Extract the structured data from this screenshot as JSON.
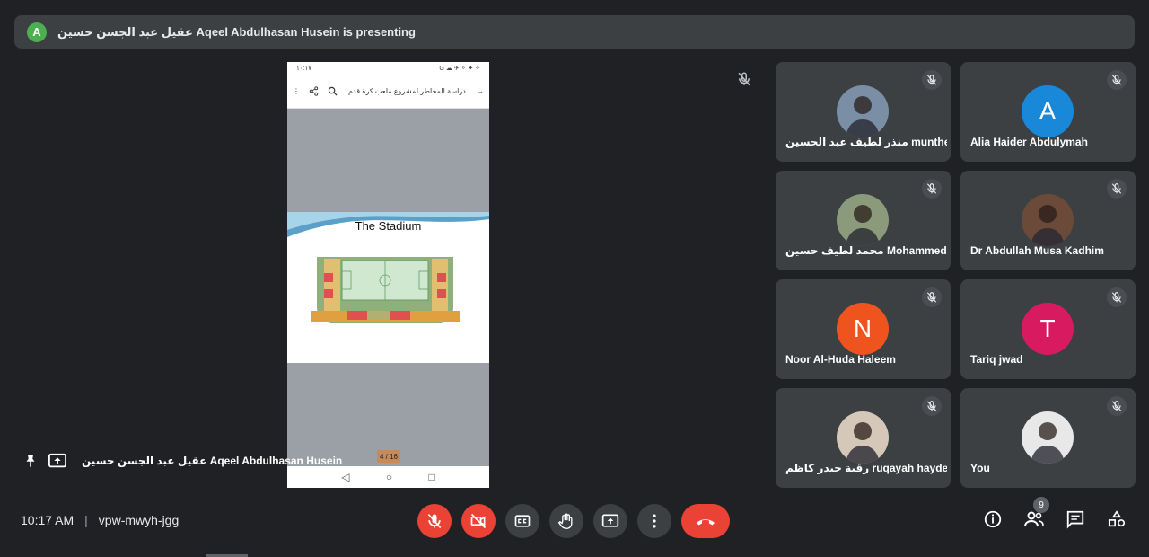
{
  "banner": {
    "avatar_letter": "A",
    "text": "عقيل عبد الجسن حسين Aqeel Abdulhasan Husein is presenting"
  },
  "presentation": {
    "status_left": "١٠:١٧",
    "status_right": "G ☁ ✈ ⚬ ✦ ✧",
    "toolbar_title": "دراسة المخاطر لمشروع ملعب كرة قدم.",
    "slide_title": "The Stadium",
    "page_indicator": "4 / 16"
  },
  "presenter_label": {
    "name": "عقيل عبد الجسن حسين Aqeel Abdulhasan Husein"
  },
  "participants": [
    {
      "name": "منذر لطيف عبد الحسين munther la...",
      "avatar_type": "photo",
      "avatar_color": "#7a8fa6",
      "muted": true
    },
    {
      "name": "Alia Haider Abdulymah",
      "avatar_type": "letter",
      "letter": "A",
      "avatar_color": "#1a88d8",
      "muted": true
    },
    {
      "name": "محمد لطيف حسين Mohammed La...",
      "avatar_type": "photo",
      "avatar_color": "#8a9a7a",
      "muted": true
    },
    {
      "name": "Dr Abdullah Musa Kadhim",
      "avatar_type": "photo",
      "avatar_color": "#6b4a3a",
      "muted": true
    },
    {
      "name": "Noor Al-Huda Haleem",
      "avatar_type": "letter",
      "letter": "N",
      "avatar_color": "#f0541e",
      "muted": true
    },
    {
      "name": "Tariq jwad",
      "avatar_type": "letter",
      "letter": "T",
      "avatar_color": "#d81b60",
      "muted": true
    },
    {
      "name": "رقية حيدر كاظم ruqayah hayder ...",
      "avatar_type": "photo",
      "avatar_color": "#d6c8b8",
      "muted": true
    },
    {
      "name": "You",
      "avatar_type": "photo",
      "avatar_color": "#e8e8e8",
      "muted": true
    }
  ],
  "meeting": {
    "time": "10:17 AM",
    "separator": "|",
    "code": "vpw-mwyh-jgg"
  },
  "people_count": "9",
  "colors": {
    "background": "#202124",
    "tile": "#3c4043",
    "danger": "#ea4335"
  }
}
